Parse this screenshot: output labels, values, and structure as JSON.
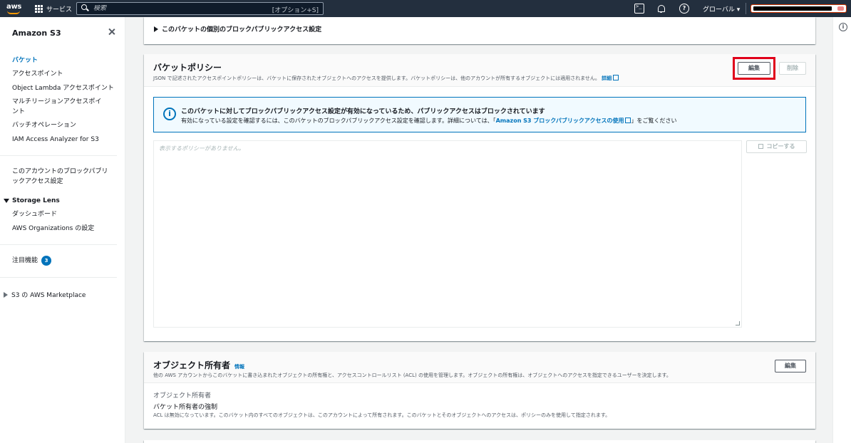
{
  "topbar": {
    "logo_text": "aws",
    "services_label": "サービス",
    "search_placeholder": "検索",
    "search_shortcut": "[オプション+S]",
    "help_glyph": "?",
    "region_label": "グローバル ▾"
  },
  "sidebar": {
    "title": "Amazon S3",
    "items": [
      {
        "label": "バケット",
        "active": true
      },
      {
        "label": "アクセスポイント"
      },
      {
        "label": "Object Lambda アクセスポイント"
      },
      {
        "label": "マルチリージョンアクセスポイ\nント"
      },
      {
        "label": "バッチオペレーション"
      },
      {
        "label": "IAM Access Analyzer for S3"
      }
    ],
    "block_public_access": "このアカウントのブロックパブリ\nックアクセス設定",
    "storage_lens": {
      "label": "Storage Lens",
      "items": [
        "ダッシュボード",
        "AWS Organizations の設定"
      ]
    },
    "featured": {
      "label": "注目機能",
      "badge": "3"
    },
    "marketplace": "S3 の AWS Marketplace"
  },
  "main": {
    "block_settings_expander": "このバケットの個別のブロックパブリックアクセス設定",
    "bucket_policy": {
      "title": "バケットポリシー",
      "description": "JSON で記述されたアクセスポイントポリシーは、バケットに保存されたオブジェクトへのアクセスを提供します。バケットポリシーは、他のアカウントが所有するオブジェクトには適用されません。",
      "details_link": "詳細",
      "edit_button": "編集",
      "delete_button": "削除",
      "alert": {
        "title": "このバケットに対してブロックパブリックアクセス設定が有効になっているため、パブリックアクセスはブロックされています",
        "body_prefix": "有効になっている設定を確認するには、このバケットのブロックパブリックアクセス設定を確認します。詳細については、「",
        "body_link": "Amazon S3 ブロックパブリックアクセスの使用",
        "body_suffix": "」をご覧ください"
      },
      "editor_placeholder": "表示するポリシーがありません。",
      "copy_button": "コピーする"
    },
    "object_ownership": {
      "title": "オブジェクト所有者",
      "info_link": "情報",
      "description": "他の AWS アカウントからこのバケットに書き込まれたオブジェクトの所有権と、アクセスコントロールリスト (ACL) の使用を管理します。オブジェクトの所有権は、オブジェクトへのアクセスを指定できるユーザーを決定します。",
      "edit_button": "編集",
      "label": "オブジェクト所有者",
      "value": "バケット所有者の強制",
      "note": "ACL は無効になっています。このバケット内のすべてのオブジェクトは、このアカウントによって所有されます。このバケットとそのオブジェクトへのアクセスは、ポリシーのみを使用して指定されます。"
    }
  },
  "colors": {
    "nav_bg": "#232f3e",
    "accent": "#0073bb",
    "highlight": "#e0001b",
    "aws_orange": "#ff9900"
  }
}
